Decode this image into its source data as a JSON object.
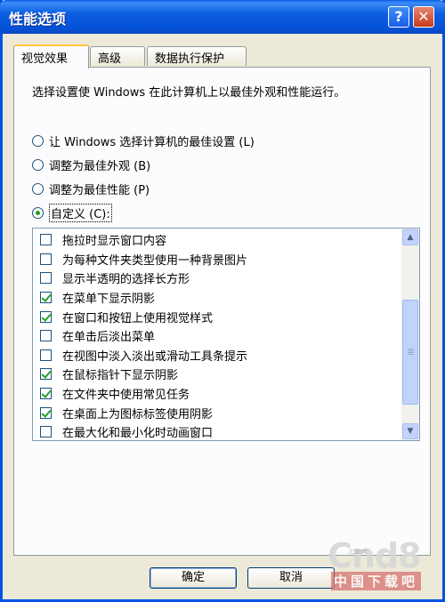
{
  "window": {
    "title": "性能选项",
    "help_label": "?",
    "close_label": "✕"
  },
  "tabs": [
    {
      "label": "视觉效果",
      "active": true
    },
    {
      "label": "高级",
      "active": false
    },
    {
      "label": "数据执行保护",
      "active": false
    }
  ],
  "description": "选择设置使 Windows 在此计算机上以最佳外观和性能运行。",
  "radios": [
    {
      "label": "让 Windows 选择计算机的最佳设置 (L)",
      "checked": false
    },
    {
      "label": "调整为最佳外观 (B)",
      "checked": false
    },
    {
      "label": "调整为最佳性能 (P)",
      "checked": false
    },
    {
      "label": "自定义 (C):",
      "checked": true
    }
  ],
  "effects": [
    {
      "label": "拖拉时显示窗口内容",
      "checked": false
    },
    {
      "label": "为每种文件夹类型使用一种背景图片",
      "checked": false
    },
    {
      "label": "显示半透明的选择长方形",
      "checked": false
    },
    {
      "label": "在菜单下显示阴影",
      "checked": true
    },
    {
      "label": "在窗口和按钮上使用视觉样式",
      "checked": true
    },
    {
      "label": "在单击后淡出菜单",
      "checked": false
    },
    {
      "label": "在视图中淡入淡出或滑动工具条提示",
      "checked": false
    },
    {
      "label": "在鼠标指针下显示阴影",
      "checked": true
    },
    {
      "label": "在文件夹中使用常见任务",
      "checked": true
    },
    {
      "label": "在桌面上为图标标签使用阴影",
      "checked": true
    },
    {
      "label": "在最大化和最小化时动画窗口",
      "checked": false
    }
  ],
  "buttons": {
    "ok": "确定",
    "cancel": "取消"
  },
  "watermark": {
    "main": "Cnd8",
    "small": ".com",
    "sub": "中国下载吧"
  }
}
